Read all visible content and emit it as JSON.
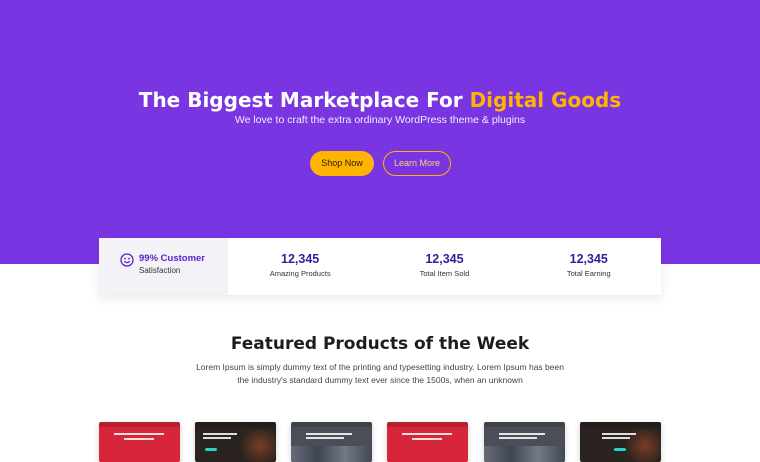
{
  "hero": {
    "title_main": "The Biggest Marketplace For",
    "title_accent": "Digital Goods",
    "subtitle": "We love to craft the extra ordinary WordPress theme & plugins",
    "shop_label": "Shop Now",
    "learn_label": "Learn More"
  },
  "stats": {
    "first": {
      "strong": "99% Customer",
      "sub": "Satisfaction",
      "icon": "smiley-icon"
    },
    "items": [
      {
        "number": "12,345",
        "label": "Amazing Products"
      },
      {
        "number": "12,345",
        "label": "Total Item Sold"
      },
      {
        "number": "12,345",
        "label": "Total Earning"
      }
    ]
  },
  "featured": {
    "title": "Featured Products of the Week",
    "description": "Lorem Ipsum is simply dummy text of the printing and typesetting industry. Lorem Ipsum has been the industry's standard dummy text ever since the 1500s, when an unknown"
  },
  "colors": {
    "hero_bg": "#7a35e3",
    "accent": "#ffb400",
    "stat_number": "#3a1c9e"
  }
}
